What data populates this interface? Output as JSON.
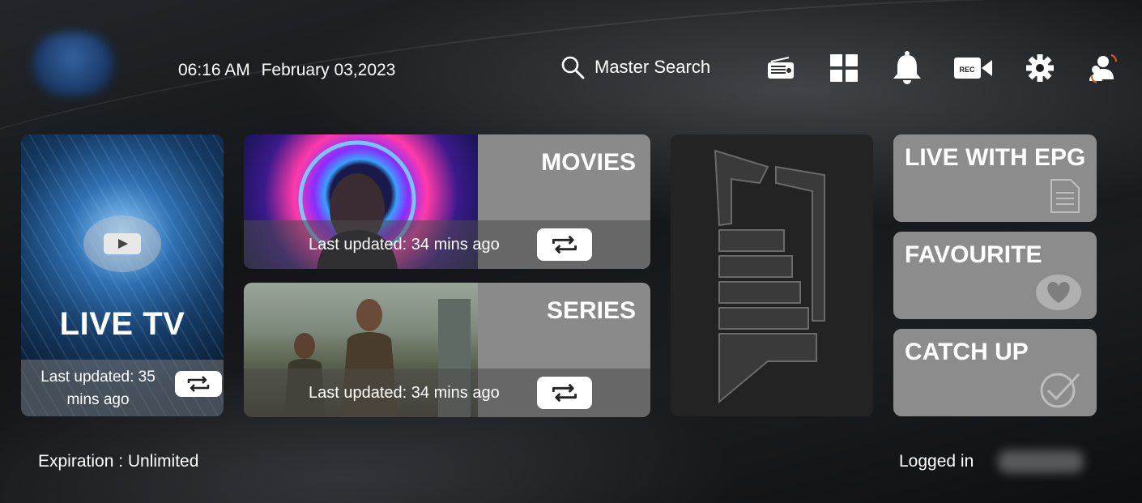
{
  "header": {
    "time": "06:16 AM",
    "date": "February 03,2023",
    "search_label": "Master Search",
    "icons": [
      "radio-icon",
      "grid-icon",
      "bell-icon",
      "rec-camera-icon",
      "gear-icon",
      "user-switch-icon"
    ],
    "rec_text": "REC"
  },
  "tiles": {
    "live_tv": {
      "label": "LIVE TV",
      "updated": "Last updated: 35 mins ago"
    },
    "movies": {
      "label": "MOVIES",
      "updated": "Last updated: 34 mins ago"
    },
    "series": {
      "label": "SERIES",
      "updated": "Last updated: 34 mins ago"
    },
    "live_with_epg": {
      "label": "LIVE WITH EPG"
    },
    "favourite": {
      "label": "FAVOURITE"
    },
    "catch_up": {
      "label": "CATCH UP"
    }
  },
  "footer": {
    "expiration": "Expiration : Unlimited",
    "logged_in": "Logged in"
  },
  "colors": {
    "tile_gray": "#8a8a8a",
    "pegasus_bg": "#232323",
    "refresh_bg": "#ffffff"
  }
}
